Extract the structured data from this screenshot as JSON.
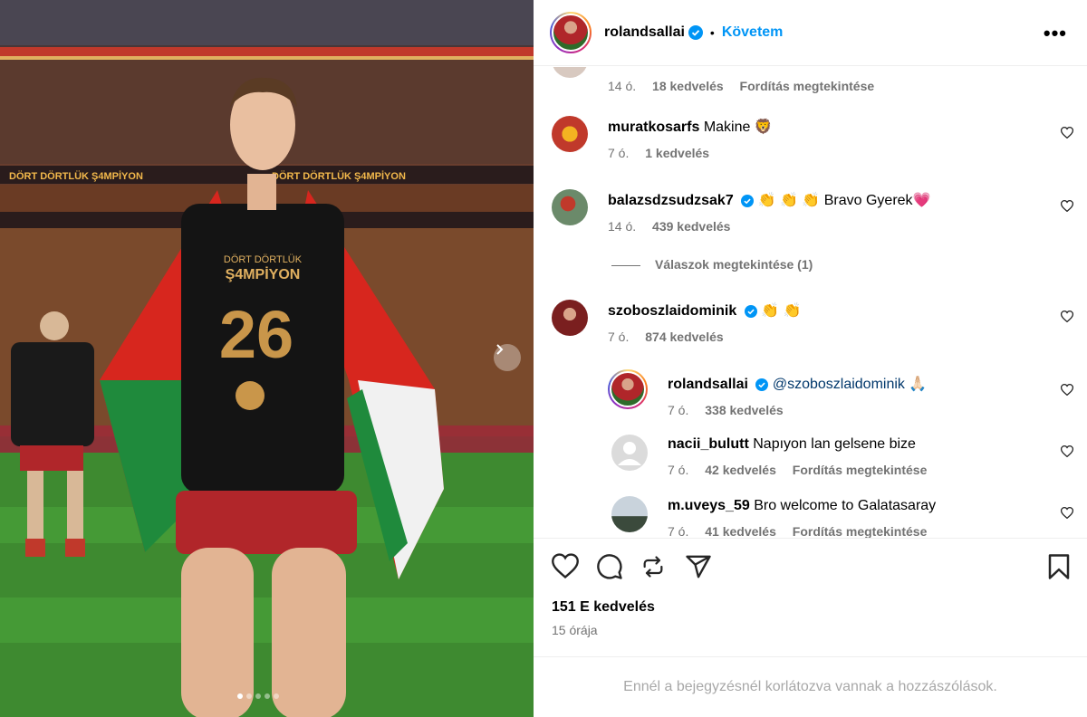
{
  "post": {
    "username": "rolandsallai",
    "follow_label": "Követem",
    "separator": "•",
    "more_label": "•••"
  },
  "comments": [
    {
      "username": "",
      "text": "",
      "time": "14 ó.",
      "likes": "18 kedvelés",
      "translate": "Fordítás megtekintése"
    },
    {
      "username": "muratkosarfs",
      "text": "Makine 🦁",
      "time": "7 ó.",
      "likes": "1 kedvelés"
    },
    {
      "username": "balazsdzsudzsak7",
      "text": "👏 👏 👏 Bravo Gyerek💗",
      "time": "14 ó.",
      "likes": "439 kedvelés",
      "view_replies": "Válaszok megtekintése (1)"
    },
    {
      "username": "szoboszlaidominik",
      "text": "👏 👏",
      "time": "7 ó.",
      "likes": "874 kedvelés"
    }
  ],
  "replies": [
    {
      "username": "rolandsallai",
      "text": "@szoboszlaidominik 🙏🏻",
      "time": "7 ó.",
      "likes": "338 kedvelés"
    },
    {
      "username": "nacii_bulutt",
      "text": "Napıyon lan gelsene bize",
      "time": "7 ó.",
      "likes": "42 kedvelés",
      "translate": "Fordítás megtekintése"
    },
    {
      "username": "m.uveys_59",
      "text": "Bro welcome to Galatasaray",
      "time": "7 ó.",
      "likes": "41 kedvelés",
      "translate": "Fordítás megtekintése"
    }
  ],
  "footer": {
    "likes": "151 E kedvelés",
    "time": "15 órája",
    "comments_limited": "Ennél a bejegyzésnél korlátozva vannak a hozzászólások."
  },
  "photo": {
    "shirt_text_top": "DÖRT DÖRTLÜK",
    "shirt_text_main": "Ş4MPİYON",
    "shirt_number": "26",
    "banner_text": "DÖRT DÖRTLÜK Ş4MPİYON",
    "carousel_total": 5,
    "carousel_current": 1
  },
  "colors": {
    "accent": "#0095f6",
    "muted": "#737373",
    "verified": "#0095f6"
  }
}
